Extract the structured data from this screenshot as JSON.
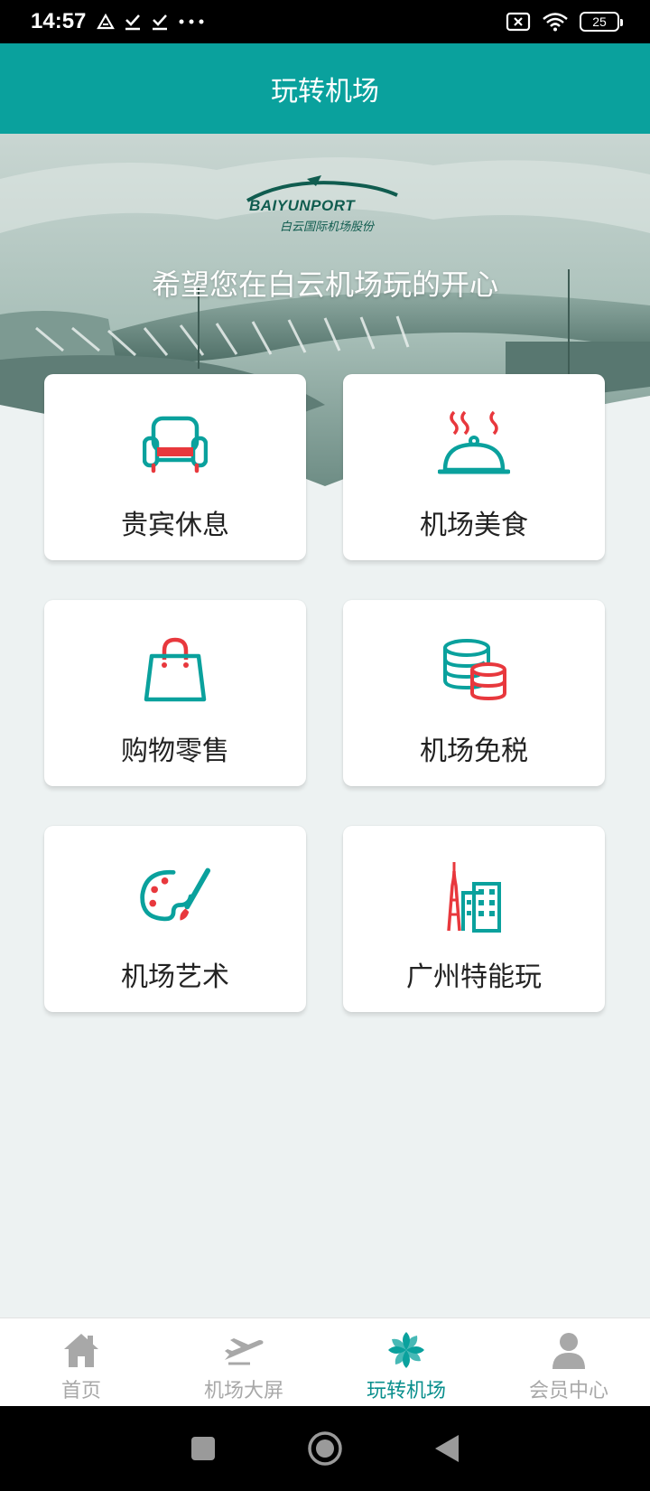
{
  "status_bar": {
    "time": "14:57",
    "battery": "25"
  },
  "header": {
    "title": "玩转机场"
  },
  "hero": {
    "logo_text": "BAIYUNPORT",
    "logo_subtext": "白云国际机场股份",
    "slogan": "希望您在白云机场玩的开心"
  },
  "cards": [
    {
      "label": "贵宾休息",
      "icon": "sofa-icon"
    },
    {
      "label": "机场美食",
      "icon": "food-cloche-icon"
    },
    {
      "label": "购物零售",
      "icon": "shopping-bag-icon"
    },
    {
      "label": "机场免税",
      "icon": "coins-icon"
    },
    {
      "label": "机场艺术",
      "icon": "palette-icon"
    },
    {
      "label": "广州特能玩",
      "icon": "city-tower-icon"
    }
  ],
  "bottom_nav": [
    {
      "label": "首页",
      "icon": "home-icon",
      "active": false
    },
    {
      "label": "机场大屏",
      "icon": "airplane-icon",
      "active": false
    },
    {
      "label": "玩转机场",
      "icon": "pinwheel-icon",
      "active": true
    },
    {
      "label": "会员中心",
      "icon": "user-icon",
      "active": false
    }
  ],
  "colors": {
    "teal": "#0aa19d",
    "red": "#e8383d",
    "inactive": "#a8a8a8",
    "background": "#edf2f2"
  }
}
